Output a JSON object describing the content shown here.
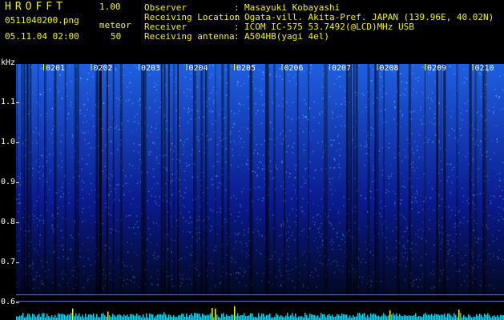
{
  "header": {
    "app_title": "HROFFT",
    "version": "1.00",
    "filename": "0511040200.png",
    "datetime": "05.11.04 02:00",
    "mode": "meteor",
    "count": "50",
    "info": [
      {
        "label": "Observer",
        "value": "Masayuki Kobayashi"
      },
      {
        "label": "Receiving Location",
        "value": "Ogata-vill. Akita-Pref. JAPAN (139.96E, 40.02N)"
      },
      {
        "label": "Receiver",
        "value": "ICOM IC-575 53.7492(@LCD)MHz USB"
      },
      {
        "label": "Receiving antenna",
        "value": "A504HB(yagi 4el)"
      }
    ]
  },
  "spectrogram": {
    "y_unit": "kHz",
    "y_ticks": [
      "1.1",
      "1.0",
      "0.9",
      "0.8",
      "0.7",
      "0.6"
    ],
    "x_ticks": [
      "0201",
      "0202",
      "0203",
      "0204",
      "0205",
      "0206",
      "0207",
      "0208",
      "0209",
      "0210"
    ],
    "colors": {
      "background": "#000000",
      "low": "#0a1a8c",
      "mid": "#1f5fe0",
      "high": "#3fe0c0",
      "peak": "#f4f40a",
      "tick": "#f4f40a"
    }
  }
}
